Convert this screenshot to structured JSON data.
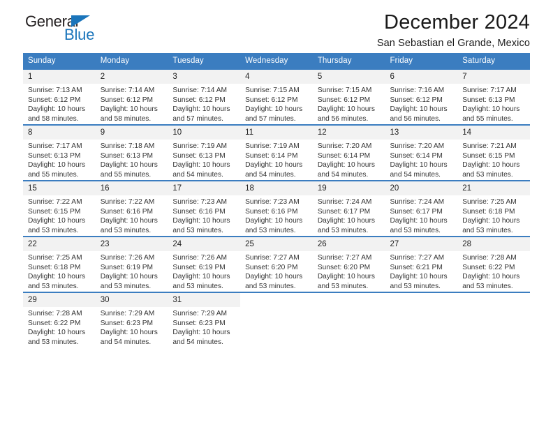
{
  "brand": {
    "name_dark": "General",
    "name_blue": "Blue",
    "accent_color": "#1b75bb"
  },
  "header": {
    "title": "December 2024",
    "subtitle": "San Sebastian el Grande, Mexico"
  },
  "theme": {
    "header_blue": "#3b7dc0",
    "daynum_bg": "#f2f2f2",
    "text": "#333333"
  },
  "weekdays": [
    "Sunday",
    "Monday",
    "Tuesday",
    "Wednesday",
    "Thursday",
    "Friday",
    "Saturday"
  ],
  "weeks": [
    [
      {
        "day": "1",
        "sunrise": "Sunrise: 7:13 AM",
        "sunset": "Sunset: 6:12 PM",
        "daylight": "Daylight: 10 hours and 58 minutes."
      },
      {
        "day": "2",
        "sunrise": "Sunrise: 7:14 AM",
        "sunset": "Sunset: 6:12 PM",
        "daylight": "Daylight: 10 hours and 58 minutes."
      },
      {
        "day": "3",
        "sunrise": "Sunrise: 7:14 AM",
        "sunset": "Sunset: 6:12 PM",
        "daylight": "Daylight: 10 hours and 57 minutes."
      },
      {
        "day": "4",
        "sunrise": "Sunrise: 7:15 AM",
        "sunset": "Sunset: 6:12 PM",
        "daylight": "Daylight: 10 hours and 57 minutes."
      },
      {
        "day": "5",
        "sunrise": "Sunrise: 7:15 AM",
        "sunset": "Sunset: 6:12 PM",
        "daylight": "Daylight: 10 hours and 56 minutes."
      },
      {
        "day": "6",
        "sunrise": "Sunrise: 7:16 AM",
        "sunset": "Sunset: 6:12 PM",
        "daylight": "Daylight: 10 hours and 56 minutes."
      },
      {
        "day": "7",
        "sunrise": "Sunrise: 7:17 AM",
        "sunset": "Sunset: 6:13 PM",
        "daylight": "Daylight: 10 hours and 55 minutes."
      }
    ],
    [
      {
        "day": "8",
        "sunrise": "Sunrise: 7:17 AM",
        "sunset": "Sunset: 6:13 PM",
        "daylight": "Daylight: 10 hours and 55 minutes."
      },
      {
        "day": "9",
        "sunrise": "Sunrise: 7:18 AM",
        "sunset": "Sunset: 6:13 PM",
        "daylight": "Daylight: 10 hours and 55 minutes."
      },
      {
        "day": "10",
        "sunrise": "Sunrise: 7:19 AM",
        "sunset": "Sunset: 6:13 PM",
        "daylight": "Daylight: 10 hours and 54 minutes."
      },
      {
        "day": "11",
        "sunrise": "Sunrise: 7:19 AM",
        "sunset": "Sunset: 6:14 PM",
        "daylight": "Daylight: 10 hours and 54 minutes."
      },
      {
        "day": "12",
        "sunrise": "Sunrise: 7:20 AM",
        "sunset": "Sunset: 6:14 PM",
        "daylight": "Daylight: 10 hours and 54 minutes."
      },
      {
        "day": "13",
        "sunrise": "Sunrise: 7:20 AM",
        "sunset": "Sunset: 6:14 PM",
        "daylight": "Daylight: 10 hours and 54 minutes."
      },
      {
        "day": "14",
        "sunrise": "Sunrise: 7:21 AM",
        "sunset": "Sunset: 6:15 PM",
        "daylight": "Daylight: 10 hours and 53 minutes."
      }
    ],
    [
      {
        "day": "15",
        "sunrise": "Sunrise: 7:22 AM",
        "sunset": "Sunset: 6:15 PM",
        "daylight": "Daylight: 10 hours and 53 minutes."
      },
      {
        "day": "16",
        "sunrise": "Sunrise: 7:22 AM",
        "sunset": "Sunset: 6:16 PM",
        "daylight": "Daylight: 10 hours and 53 minutes."
      },
      {
        "day": "17",
        "sunrise": "Sunrise: 7:23 AM",
        "sunset": "Sunset: 6:16 PM",
        "daylight": "Daylight: 10 hours and 53 minutes."
      },
      {
        "day": "18",
        "sunrise": "Sunrise: 7:23 AM",
        "sunset": "Sunset: 6:16 PM",
        "daylight": "Daylight: 10 hours and 53 minutes."
      },
      {
        "day": "19",
        "sunrise": "Sunrise: 7:24 AM",
        "sunset": "Sunset: 6:17 PM",
        "daylight": "Daylight: 10 hours and 53 minutes."
      },
      {
        "day": "20",
        "sunrise": "Sunrise: 7:24 AM",
        "sunset": "Sunset: 6:17 PM",
        "daylight": "Daylight: 10 hours and 53 minutes."
      },
      {
        "day": "21",
        "sunrise": "Sunrise: 7:25 AM",
        "sunset": "Sunset: 6:18 PM",
        "daylight": "Daylight: 10 hours and 53 minutes."
      }
    ],
    [
      {
        "day": "22",
        "sunrise": "Sunrise: 7:25 AM",
        "sunset": "Sunset: 6:18 PM",
        "daylight": "Daylight: 10 hours and 53 minutes."
      },
      {
        "day": "23",
        "sunrise": "Sunrise: 7:26 AM",
        "sunset": "Sunset: 6:19 PM",
        "daylight": "Daylight: 10 hours and 53 minutes."
      },
      {
        "day": "24",
        "sunrise": "Sunrise: 7:26 AM",
        "sunset": "Sunset: 6:19 PM",
        "daylight": "Daylight: 10 hours and 53 minutes."
      },
      {
        "day": "25",
        "sunrise": "Sunrise: 7:27 AM",
        "sunset": "Sunset: 6:20 PM",
        "daylight": "Daylight: 10 hours and 53 minutes."
      },
      {
        "day": "26",
        "sunrise": "Sunrise: 7:27 AM",
        "sunset": "Sunset: 6:20 PM",
        "daylight": "Daylight: 10 hours and 53 minutes."
      },
      {
        "day": "27",
        "sunrise": "Sunrise: 7:27 AM",
        "sunset": "Sunset: 6:21 PM",
        "daylight": "Daylight: 10 hours and 53 minutes."
      },
      {
        "day": "28",
        "sunrise": "Sunrise: 7:28 AM",
        "sunset": "Sunset: 6:22 PM",
        "daylight": "Daylight: 10 hours and 53 minutes."
      }
    ],
    [
      {
        "day": "29",
        "sunrise": "Sunrise: 7:28 AM",
        "sunset": "Sunset: 6:22 PM",
        "daylight": "Daylight: 10 hours and 53 minutes."
      },
      {
        "day": "30",
        "sunrise": "Sunrise: 7:29 AM",
        "sunset": "Sunset: 6:23 PM",
        "daylight": "Daylight: 10 hours and 54 minutes."
      },
      {
        "day": "31",
        "sunrise": "Sunrise: 7:29 AM",
        "sunset": "Sunset: 6:23 PM",
        "daylight": "Daylight: 10 hours and 54 minutes."
      },
      {
        "day": "",
        "sunrise": "",
        "sunset": "",
        "daylight": ""
      },
      {
        "day": "",
        "sunrise": "",
        "sunset": "",
        "daylight": ""
      },
      {
        "day": "",
        "sunrise": "",
        "sunset": "",
        "daylight": ""
      },
      {
        "day": "",
        "sunrise": "",
        "sunset": "",
        "daylight": ""
      }
    ]
  ]
}
